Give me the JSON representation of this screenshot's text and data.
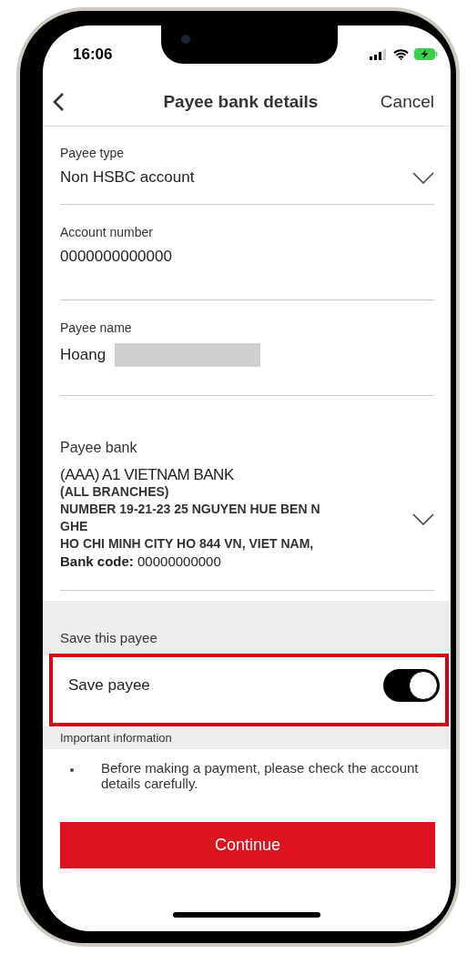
{
  "status_bar": {
    "time": "16:06"
  },
  "nav": {
    "title": "Payee bank details",
    "cancel": "Cancel"
  },
  "fields": [
    {
      "kind": "select",
      "label": "Payee type",
      "value": "Non HSBC account"
    },
    {
      "kind": "text",
      "label": "Account number",
      "value": "0000000000000"
    },
    {
      "kind": "redacted",
      "label": "Payee name",
      "value": "Hoang"
    }
  ],
  "payee_bank": {
    "label": "Payee bank",
    "name": "(AAA) A1 VIETNAM BANK",
    "address_lines": [
      "(ALL BRANCHES)",
      "NUMBER 19-21-23 25 NGUYEN HUE BEN N",
      "GHE",
      "HO CHI MINH CITY HO 844 VN, VIET NAM,"
    ],
    "code": "**Bank code:** 00000000000"
  },
  "save_section": {
    "heading": "Save this payee",
    "toggle": {
      "label": "Save payee",
      "on": true,
      "highlighted": true
    }
  },
  "important": {
    "heading": "Important information",
    "bullets": [
      "Before making a payment, please check the account details carefully."
    ]
  },
  "continue_button": "Continue"
}
